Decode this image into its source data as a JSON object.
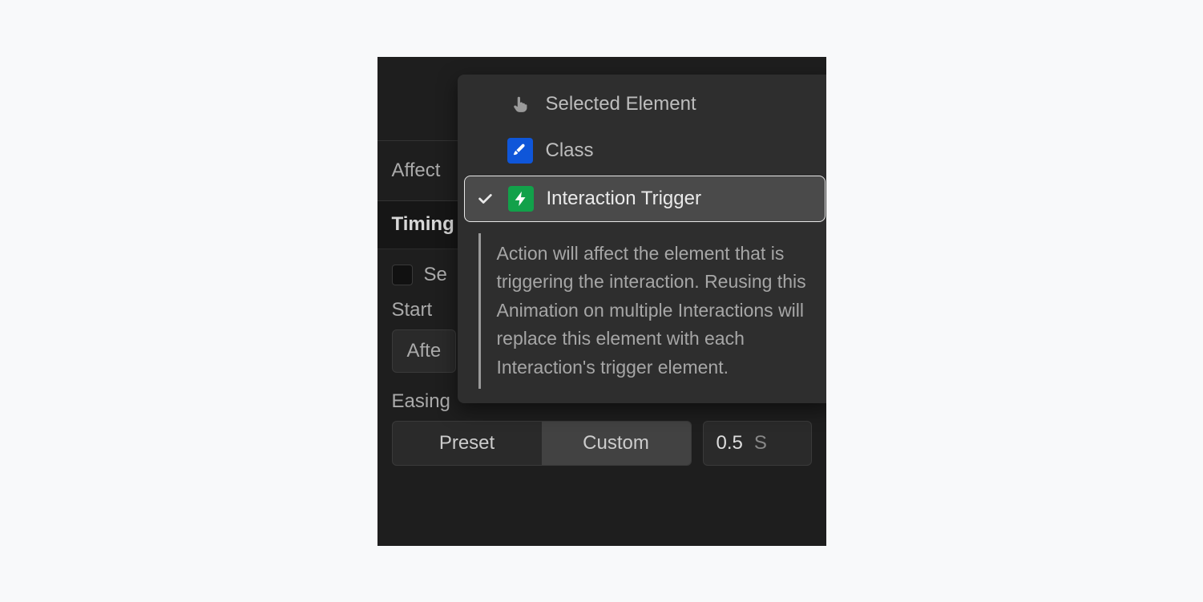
{
  "labels": {
    "affect": "Affect",
    "timing_header": "Timing",
    "set_initial_state": "Set initial state",
    "set_initial_state_visible": "Se",
    "start": "Start",
    "start_value_visible": "Afte",
    "easing": "Easing"
  },
  "dropdown": {
    "items": [
      {
        "label": "Selected Element",
        "icon": "hand-pointer-icon",
        "selected": false
      },
      {
        "label": "Class",
        "icon": "brush-icon",
        "selected": false
      },
      {
        "label": "Interaction Trigger",
        "icon": "bolt-icon",
        "selected": true
      }
    ],
    "description": "Action will affect the element that is triggering the interaction. Reusing this Animation on multiple Interactions will replace this element with each Interaction's trigger element."
  },
  "easing": {
    "tabs": [
      "Preset",
      "Custom"
    ],
    "active_ix": 1,
    "duration_value": "0.5",
    "duration_unit": "S"
  }
}
